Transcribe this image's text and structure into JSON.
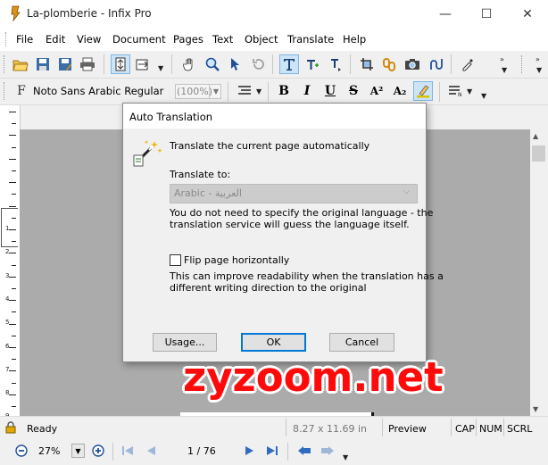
{
  "window": {
    "title": "La-plomberie - Infix Pro",
    "controls": {
      "minimize": "—",
      "maximize": "☐",
      "close": "✕"
    }
  },
  "menu": [
    "File",
    "Edit",
    "View",
    "Document",
    "Pages",
    "Text",
    "Object",
    "Translate",
    "Help"
  ],
  "fontbar": {
    "font_name": "Noto Sans Arabic Regular",
    "zoom_combo": "(100%)",
    "style_buttons": [
      "B",
      "I",
      "U",
      "S",
      "A²",
      "A₂"
    ]
  },
  "dialog": {
    "title": "Auto Translation",
    "heading": "Translate the current page automatically",
    "translate_to_label": "Translate to:",
    "language_value": "Arabic - العربية",
    "language_note_line1": "You do not need to specify the original language - the",
    "language_note_line2": "translation service will guess the language itself.",
    "flip_label": "Flip page horizontally",
    "flip_checked": false,
    "flip_note_line1": "This can improve readability when the translation has a",
    "flip_note_line2": "different writing direction to the original",
    "usage_button": "Usage...",
    "ok_button": "OK",
    "cancel_button": "Cancel"
  },
  "watermark": "zyzoom.net",
  "status": {
    "ready": "Ready",
    "page_size": "8.27 x 11.69 in",
    "preview": "Preview",
    "cap": "CAP",
    "num": "NUM",
    "scrl": "SCRL"
  },
  "nav": {
    "zoom": "27%",
    "page_counter": "1 / 76"
  },
  "ruler_labels": [
    "1",
    "2",
    "3",
    "4",
    "5",
    "6",
    "7",
    "8",
    "9"
  ],
  "colors": {
    "accent": "#0078d7",
    "canvas": "#ababab",
    "watermark": "#ff0a0a"
  }
}
